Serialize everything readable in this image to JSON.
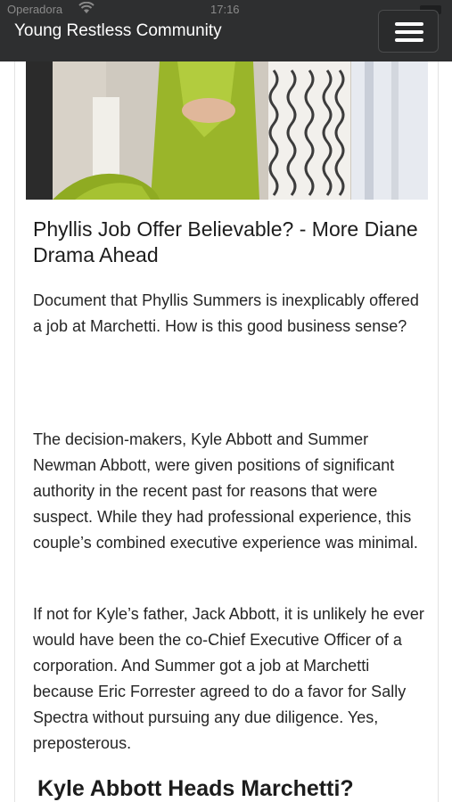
{
  "status_bar": {
    "carrier": "Operadora",
    "time": "17:16"
  },
  "navbar": {
    "brand": "Young Restless Community",
    "menu_icon": "hamburger-menu-icon"
  },
  "article": {
    "image_icon": "article-photo",
    "title": "Phyllis Job Offer Believable? - More Diane Drama Ahead",
    "paragraphs": [
      "Document that Phyllis Summers  is inexplicably offered a job at Marchetti. How is this good business sense?",
      "The decision-makers, Kyle Abbott  and Summer Newman Abbott, were given positions of significant authority in the recent past for reasons that were suspect. While they had professional experience, this couple’s combined executive experience was minimal.",
      "If not for Kyle’s father, Jack Abbott, it is unlikely he ever would have been the co-Chief Executive Officer of a corporation. And Summer got a job at Marchetti because Eric Forrester  agreed to do a favor for Sally Spectra  without pursuing any due diligence. Yes, preposterous."
    ],
    "subheading": "Kyle Abbott Heads Marchetti?"
  },
  "colors": {
    "navbar_bg": "#2e2f30",
    "navbar_text": "#ffffff",
    "page_bg": "#ffffff",
    "dress_green": "#9ab52a"
  }
}
